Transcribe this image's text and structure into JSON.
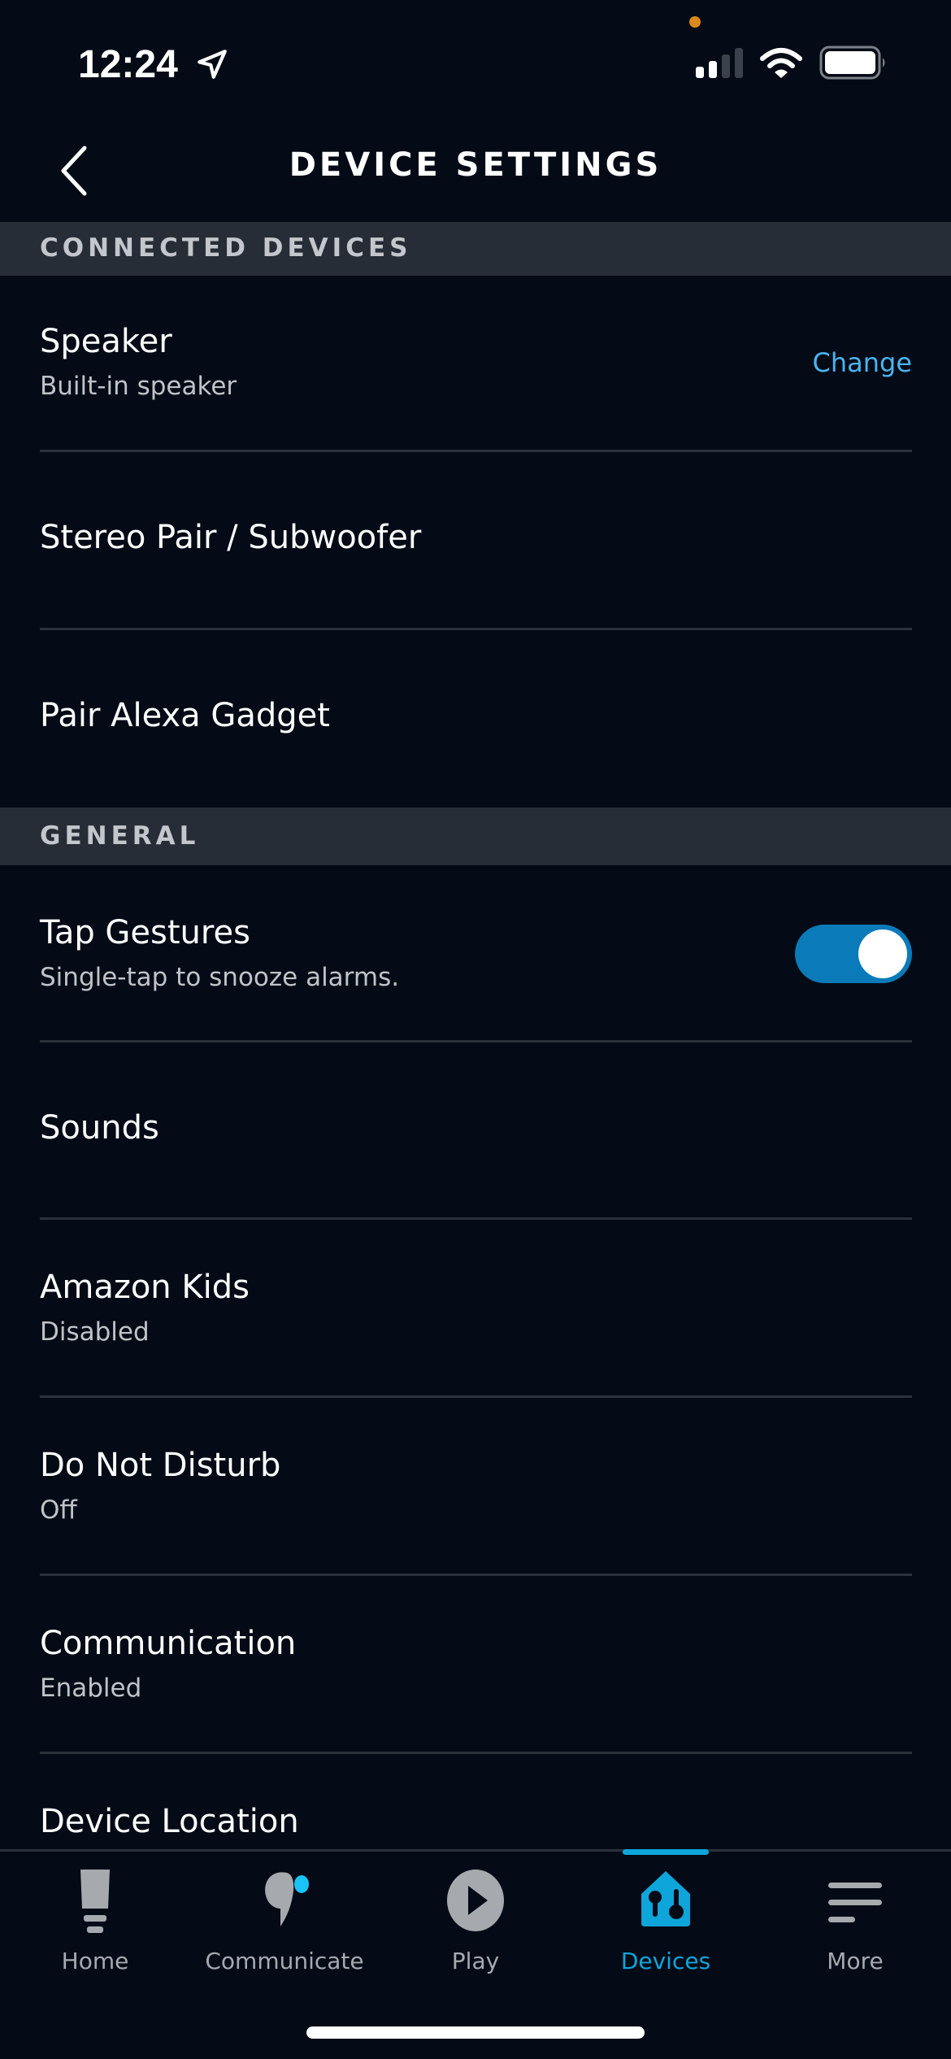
{
  "status_bar": {
    "time": "12:24",
    "icons": [
      "location-arrow-icon",
      "signal-icon",
      "wifi-icon",
      "battery-icon"
    ],
    "signal_bars_active": 2,
    "signal_bars_total": 4,
    "battery_level": 0.85,
    "privacy_dot_color": "#d9891a"
  },
  "header": {
    "title": "DEVICE SETTINGS",
    "back_icon": "chevron-left-icon"
  },
  "sections": [
    {
      "label": "CONNECTED DEVICES",
      "rows": [
        {
          "title": "Speaker",
          "subtitle": "Built-in speaker",
          "action": "Change"
        },
        {
          "title": "Stereo Pair / Subwoofer"
        },
        {
          "title": "Pair Alexa Gadget"
        }
      ]
    },
    {
      "label": "GENERAL",
      "rows": [
        {
          "title": "Tap Gestures",
          "subtitle": "Single-tap to snooze alarms.",
          "toggle_on": true
        },
        {
          "title": "Sounds"
        },
        {
          "title": "Amazon Kids",
          "subtitle": "Disabled"
        },
        {
          "title": "Do Not Disturb",
          "subtitle": "Off"
        },
        {
          "title": "Communication",
          "subtitle": "Enabled"
        },
        {
          "title": "Device Location"
        }
      ]
    }
  ],
  "bottom_nav": {
    "items": [
      {
        "label": "Home",
        "icon": "home-icon",
        "active": false
      },
      {
        "label": "Communicate",
        "icon": "communicate-icon",
        "active": false,
        "badge": true
      },
      {
        "label": "Play",
        "icon": "play-icon",
        "active": false
      },
      {
        "label": "Devices",
        "icon": "devices-icon",
        "active": true
      },
      {
        "label": "More",
        "icon": "more-icon",
        "active": false
      }
    ]
  },
  "colors": {
    "background": "#040b16",
    "section_band": "#262d37",
    "accent": "#0ea5db",
    "link": "#4ab3ee",
    "toggle_on": "#0a7ab9",
    "inactive_icon": "#a6aaaf",
    "badge": "#19c3f5"
  }
}
